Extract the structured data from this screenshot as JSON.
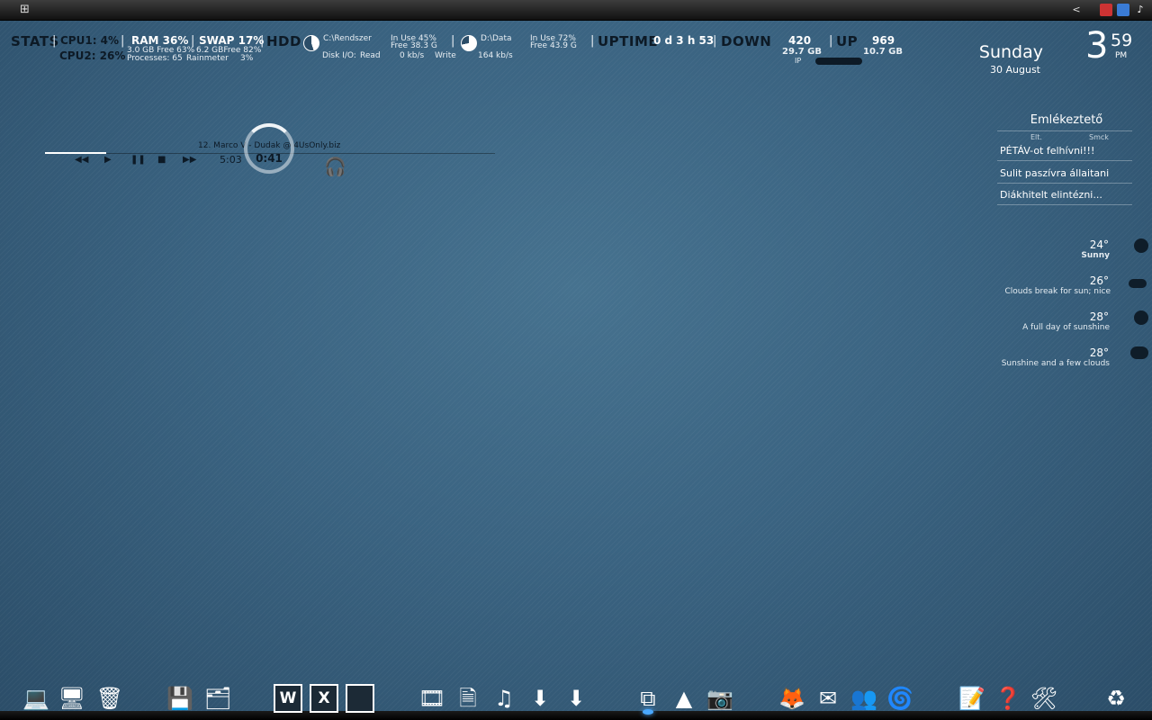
{
  "tray": {
    "arrow": "<"
  },
  "stats": {
    "label": "STATS",
    "cpu1": "CPU1: 4%",
    "cpu2": "CPU2: 26%",
    "ram": "RAM 36%",
    "ram_free": "3.0 GB Free 63%",
    "swap": "SWAP 17%",
    "swap_free": "6.2 GBFree 82%",
    "processes": "Processes: 65",
    "rainmeter": "Rainmeter",
    "rainmeter_pct": "3%",
    "hdd": "HDD",
    "drive_c": "C:\\Rendszer",
    "drive_c_use": "In Use 45%",
    "drive_c_free": "Free 38.3 G",
    "drive_d": "D:\\Data",
    "drive_d_use": "In Use 72%",
    "drive_d_free": "Free 43.9 G",
    "disk_io": "Disk I/O:",
    "read_label": "Read",
    "read_value": "0 kb/s",
    "write_label": "Write",
    "write_value": "164 kb/s",
    "uptime_label": "UPTIME",
    "uptime_value": "0 d 3 h 53",
    "down_label": "DOWN",
    "down_value": "420",
    "down_total": "29.7 GB",
    "ip_label": "IP",
    "up_label": "UP",
    "up_value": "969",
    "up_total": "10.7 GB"
  },
  "player": {
    "track": "12. Marco V - Dudak @ 4UsOnly.biz",
    "duration": "5:03",
    "position": "0:41",
    "progress": 0.135
  },
  "clock": {
    "day": "Sunday",
    "date": "30 August",
    "hour": "3",
    "minute": "59",
    "ampm": "PM"
  },
  "reminders": {
    "title": "Emlékeztető",
    "head_left": "Elt.",
    "head_right": "Smck",
    "items": [
      "PÉTÁV-ot felhívni!!!",
      "Sulit paszívra állaitani",
      "Diákhitelt elintézni..."
    ]
  },
  "weather": [
    {
      "temp": "24°",
      "desc": "Sunny",
      "icon": "sun-icon"
    },
    {
      "temp": "26°",
      "desc": "Clouds break for sun; nice",
      "icon": "cloud-sun-icon"
    },
    {
      "temp": "28°",
      "desc": "A full day of sunshine",
      "icon": "sun-icon"
    },
    {
      "temp": "28°",
      "desc": "Sunshine and a few clouds",
      "icon": "cloud-sun-icon"
    }
  ],
  "dock": {
    "word": "W",
    "excel": "X"
  }
}
